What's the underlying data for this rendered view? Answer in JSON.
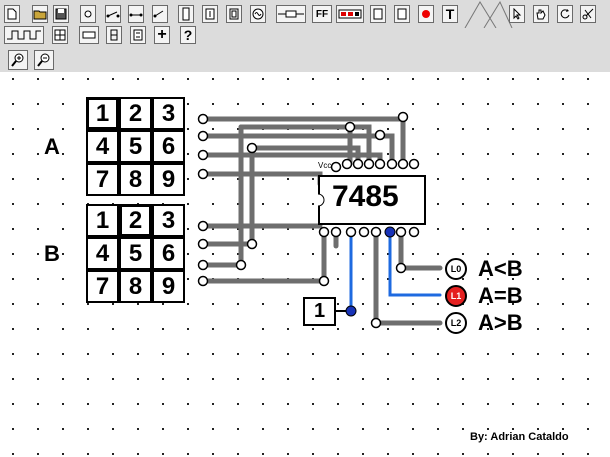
{
  "toolbar": {
    "tools_row1": [
      "new-file",
      "open-folder",
      "save",
      "node",
      "switch-open",
      "switch-closed",
      "switch-toggle",
      "relay",
      "gnd-connector",
      "connector",
      "clock",
      "resistor",
      "flip-flop",
      "dip-switch",
      "led-bar",
      "chip",
      "red-dot",
      "text-tool"
    ],
    "ff_label": "FF",
    "text_tool_label": "T",
    "plus_label": "+",
    "help_label": "?",
    "right_tools": [
      "pointer",
      "hand",
      "rotate",
      "cut"
    ]
  },
  "circuit": {
    "chip_name": "7485",
    "vcc_label": "Vcc",
    "group_a_label": "A",
    "group_b_label": "B",
    "keypad_a": [
      "1",
      "2",
      "3",
      "4",
      "5",
      "6",
      "7",
      "8",
      "9"
    ],
    "keypad_b": [
      "1",
      "2",
      "3",
      "4",
      "5",
      "6",
      "7",
      "8",
      "9"
    ],
    "input_one": "1",
    "outputs": [
      {
        "led": "L0",
        "label": "A<B",
        "on": false
      },
      {
        "led": "L1",
        "label": "A=B",
        "on": true
      },
      {
        "led": "L2",
        "label": "A>B",
        "on": false
      }
    ],
    "author": "By: Adrian Cataldo"
  },
  "colors": {
    "wire": "#6e6e6e",
    "active_wire": "#1e6ae0",
    "led_on": "#e52020",
    "grid_dot": "#222222",
    "toolbar_bg": "#dcdcdc"
  }
}
